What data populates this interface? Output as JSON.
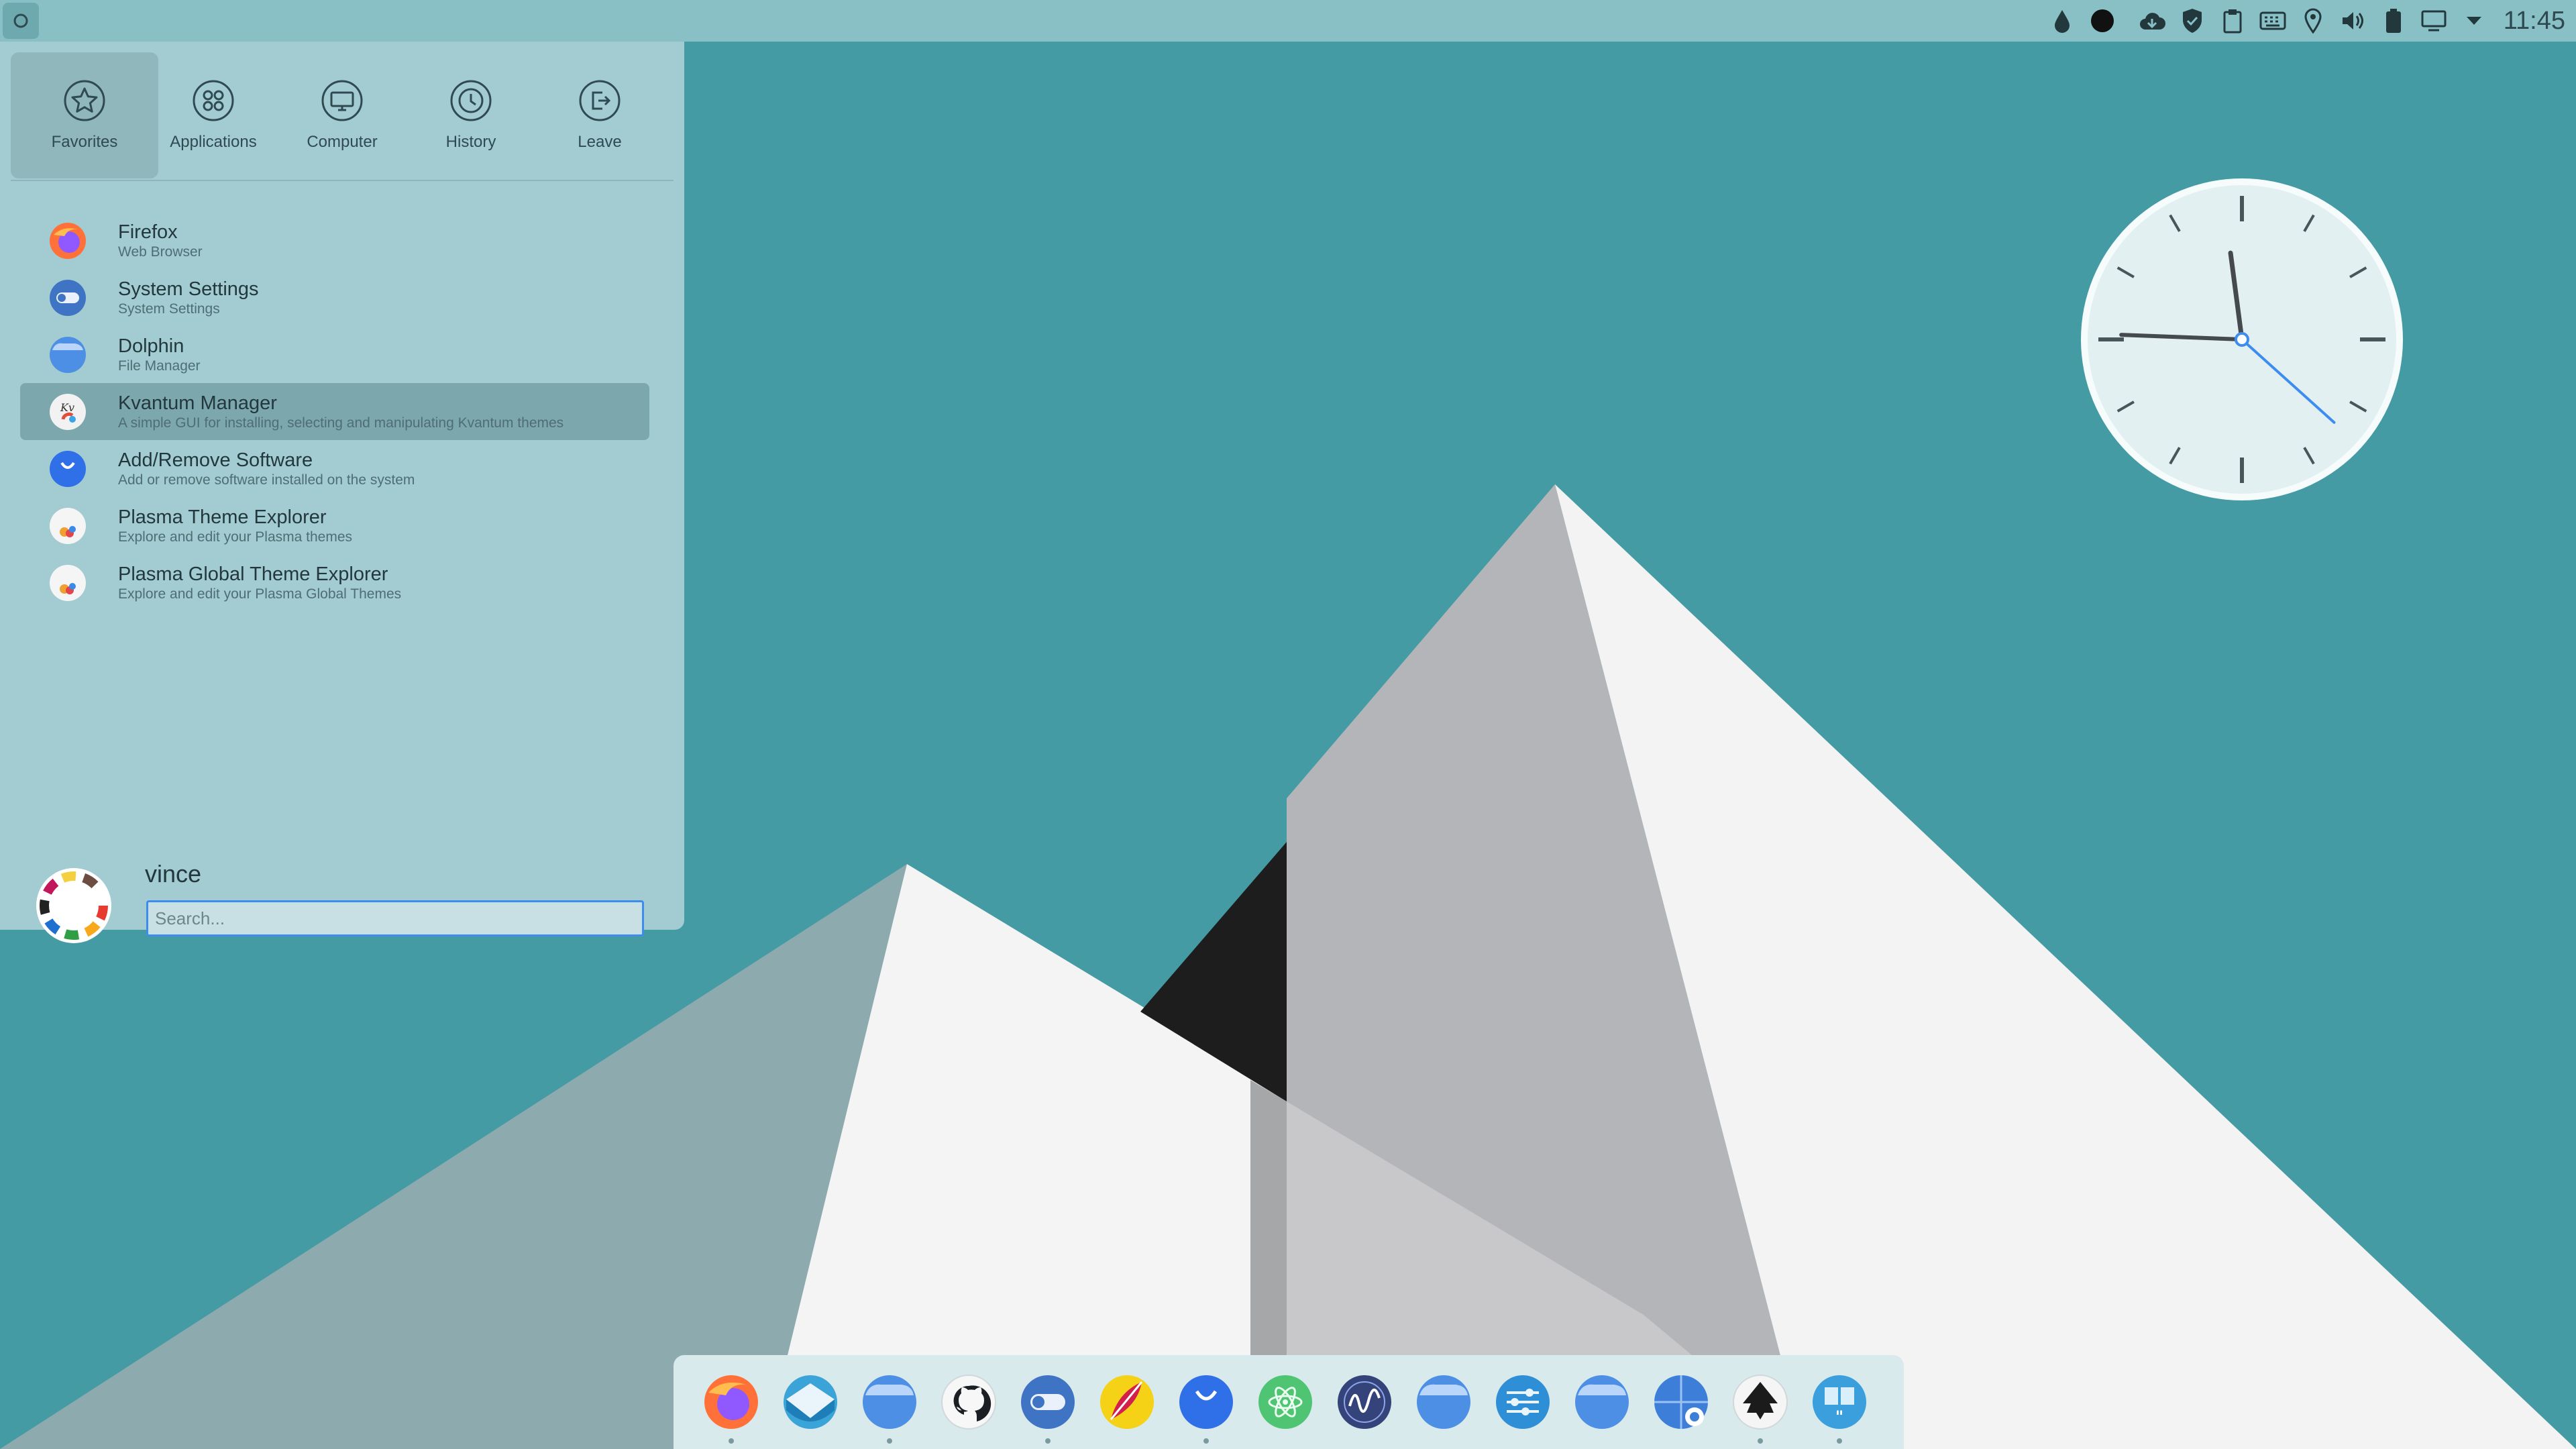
{
  "topbar": {
    "clock_text": "11:45",
    "tray_icons": [
      "water-drop-icon",
      "circle-icon",
      "cloud-icon",
      "shield-icon",
      "clipboard-icon",
      "keyboard-icon",
      "location-pin-icon",
      "speaker-icon",
      "battery-icon",
      "display-icon",
      "chevron-down-icon"
    ]
  },
  "menu": {
    "tabs": [
      {
        "label": "Favorites",
        "icon": "star-icon",
        "active": true
      },
      {
        "label": "Applications",
        "icon": "grid-icon"
      },
      {
        "label": "Computer",
        "icon": "monitor-icon"
      },
      {
        "label": "History",
        "icon": "clock-icon"
      },
      {
        "label": "Leave",
        "icon": "exit-icon"
      }
    ],
    "favorites": [
      {
        "name": "Firefox",
        "desc": "Web Browser",
        "icon": "firefox-icon"
      },
      {
        "name": "System Settings",
        "desc": "System Settings",
        "icon": "toggle-icon"
      },
      {
        "name": "Dolphin",
        "desc": "File Manager",
        "icon": "folder-icon"
      },
      {
        "name": "Kvantum Manager",
        "desc": "A simple GUI for installing, selecting and manipulating Kvantum themes",
        "icon": "kvantum-icon"
      },
      {
        "name": "Add/Remove Software",
        "desc": "Add or remove software installed on the system",
        "icon": "bag-icon"
      },
      {
        "name": "Plasma Theme Explorer",
        "desc": "Explore and edit your Plasma themes",
        "icon": "palette-icon"
      },
      {
        "name": "Plasma Global Theme Explorer",
        "desc": "Explore and edit your Plasma Global Themes",
        "icon": "palette-icon"
      }
    ],
    "user": {
      "name": "vince"
    },
    "search": {
      "placeholder": "Search..."
    }
  },
  "clock_widget": {
    "hour": 11,
    "minute": 45,
    "second": 22
  },
  "dock": {
    "items": [
      {
        "name": "firefox",
        "icon": "firefox-icon",
        "running": true
      },
      {
        "name": "mail",
        "icon": "mail-icon"
      },
      {
        "name": "folder",
        "icon": "folder-icon",
        "running": true
      },
      {
        "name": "github",
        "icon": "github-icon"
      },
      {
        "name": "settings",
        "icon": "toggle-icon",
        "running": true
      },
      {
        "name": "paint",
        "icon": "paint-icon"
      },
      {
        "name": "discover",
        "icon": "bag-icon",
        "running": true
      },
      {
        "name": "atom",
        "icon": "atom-icon"
      },
      {
        "name": "monitor",
        "icon": "wave-icon"
      },
      {
        "name": "folder-2",
        "icon": "folder-icon"
      },
      {
        "name": "mixer",
        "icon": "sliders-icon"
      },
      {
        "name": "folder-3",
        "icon": "folder-icon"
      },
      {
        "name": "web",
        "icon": "globe-icon"
      },
      {
        "name": "inkscape",
        "icon": "inkscape-icon",
        "running": true
      },
      {
        "name": "quote",
        "icon": "quote-icon",
        "running": true
      }
    ]
  },
  "colors": {
    "accent": "#3d8df0",
    "panel": "#a2ccd1",
    "desktop": "#459ba4"
  }
}
